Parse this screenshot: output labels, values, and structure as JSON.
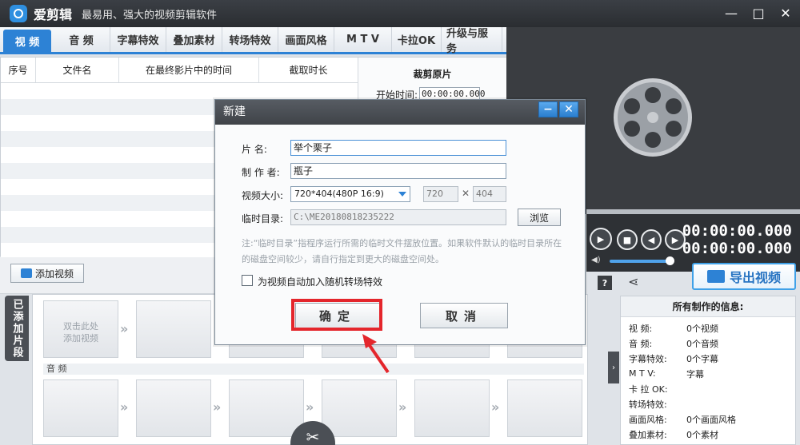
{
  "app": {
    "title": "爱剪辑",
    "subtitle": "最易用、强大的视频剪辑软件",
    "win_min": "—",
    "win_max": "□",
    "win_close": "✕"
  },
  "tabs": [
    "视 频",
    "音 频",
    "字幕特效",
    "叠加素材",
    "转场特效",
    "画面风格",
    "M T V",
    "卡拉OK",
    "升级与服务"
  ],
  "file_table": {
    "headers": [
      "序号",
      "文件名",
      "在最终影片中的时间",
      "截取时长"
    ],
    "crop_title": "裁剪原片",
    "start_label": "开始时间:",
    "start_value": "00:00:00.000"
  },
  "player": {
    "time_current": "00:00:00.000",
    "time_total": "00:00:00.000",
    "volume": 0.9
  },
  "export": {
    "label": "导出视频"
  },
  "add_video": {
    "label": "添加视频"
  },
  "timeline": {
    "side_tab": "已添加片段",
    "placeholder": "双击此处\n添加视频",
    "audio_label": "音 频"
  },
  "stats": {
    "title": "所有制作的信息:",
    "rows": [
      {
        "k": "视    频:",
        "v": "0个视频"
      },
      {
        "k": "音    频:",
        "v": "0个音频"
      },
      {
        "k": "字幕特效:",
        "v": "0个字幕"
      },
      {
        "k": "M T V:",
        "v": "字幕"
      },
      {
        "k": "卡 拉 OK:",
        "v": ""
      },
      {
        "k": "转场特效:",
        "v": ""
      },
      {
        "k": "画面风格:",
        "v": "0个画面风格"
      },
      {
        "k": "叠加素材:",
        "v": "0个素材"
      }
    ]
  },
  "dialog": {
    "title": "新建",
    "name_label": "片    名:",
    "name_value": "举个栗子",
    "author_label": "制 作 者:",
    "author_value": "瓶子",
    "size_label": "视频大小:",
    "size_value": "720*404(480P 16:9)",
    "width_value": "720",
    "times": "✕",
    "height_value": "404",
    "temp_label": "临时目录:",
    "temp_value": "C:\\ME20180818235222",
    "browse": "浏览",
    "note": "注:“临时目录”指程序运行所需的临时文件摆放位置。如果软件默认的临时目录所在的磁盘空间较少，请自行指定到更大的磁盘空间处。",
    "checkbox_label": "为视频自动加入随机转场特效",
    "ok": "确定",
    "cancel": "取消"
  }
}
